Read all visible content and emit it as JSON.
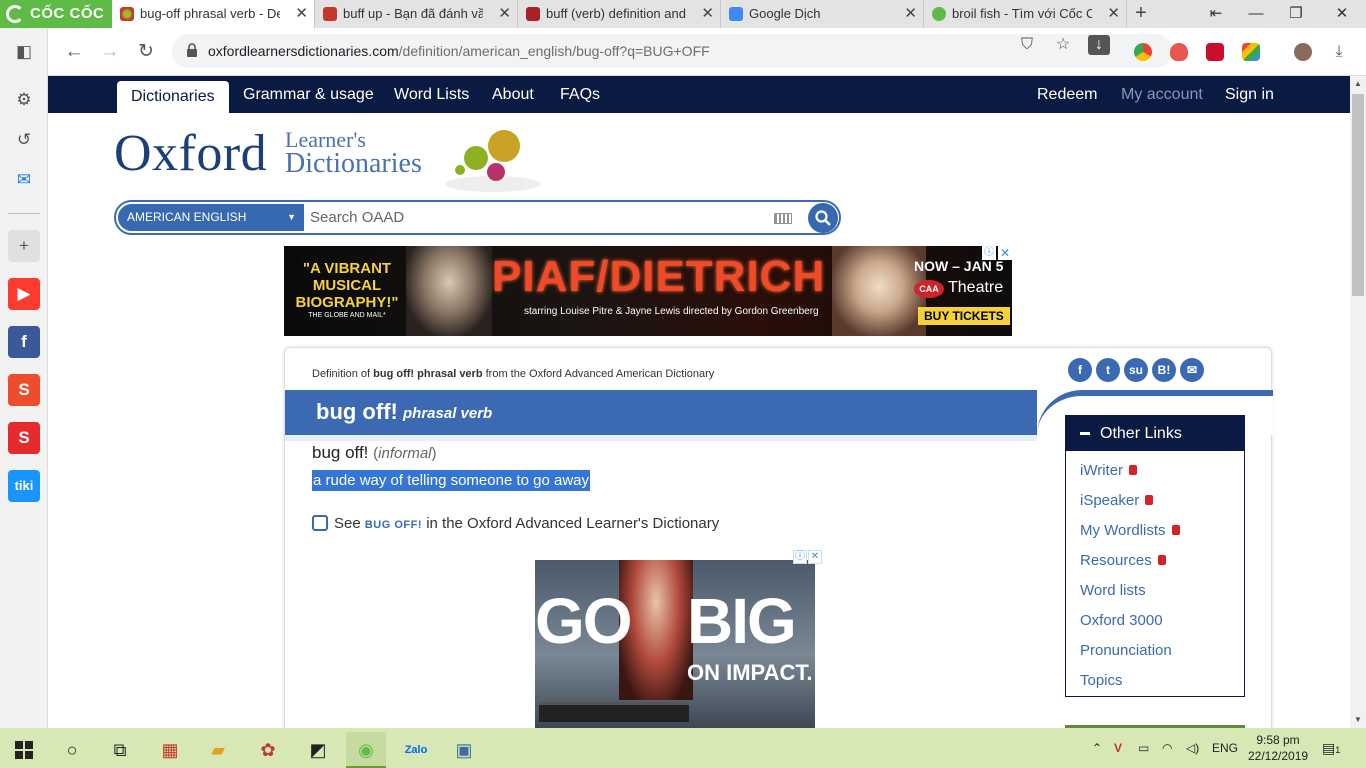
{
  "browser": {
    "brand": "CỐC CỐC",
    "tabs": [
      {
        "title": "bug-off phrasal verb - Definition",
        "active": true
      },
      {
        "title": "buff up - Bạn đã đánh vần",
        "active": false
      },
      {
        "title": "buff (verb) definition and sy",
        "active": false
      },
      {
        "title": "Google Dịch",
        "active": false
      },
      {
        "title": "broil fish - Tìm với Cốc Cốc",
        "active": false
      }
    ],
    "url_host": "oxfordlearnersdictionaries.com",
    "url_path": "/definition/american_english/bug-off?q=BUG+OFF"
  },
  "site_nav": {
    "left": [
      "Dictionaries",
      "Grammar & usage",
      "Word Lists",
      "About",
      "FAQs"
    ],
    "right": [
      "Redeem",
      "My account",
      "Sign in"
    ]
  },
  "logo": {
    "brand": "Oxford",
    "line1": "Learner's",
    "line2": "Dictionaries"
  },
  "search": {
    "language": "AMERICAN ENGLISH",
    "placeholder": "Search OAAD"
  },
  "top_ad": {
    "quote": "\"A VIBRANT MUSICAL BIOGRAPHY!\"",
    "quote_source": "THE GLOBE AND MAIL*",
    "title": "PIAF/DIETRICH",
    "starring": "starring Louise Pitre & Jayne Lewis  directed by Gordon Greenberg",
    "dates": "NOW – JAN 5",
    "venue_logo": "CAA",
    "venue": "Theatre",
    "cta": "BUY TICKETS"
  },
  "entry": {
    "breadcrumb_pre": "Definition of ",
    "breadcrumb_term": "bug off! phrasal verb",
    "breadcrumb_post": " from the Oxford Advanced American Dictionary",
    "headword": "bug off!",
    "pos": "phrasal verb",
    "form": "bug off!",
    "register": "informal",
    "definition": "a rude way of telling someone to go away",
    "see_pre": "See ",
    "see_ref": "BUG OFF!",
    "see_post": " in the Oxford Advanced Learner's Dictionary"
  },
  "share_icons": [
    "facebook-icon",
    "twitter-icon",
    "stumbleupon-icon",
    "hatena-icon",
    "email-icon"
  ],
  "side_ad": {
    "text1": "GO",
    "text2": "BIG",
    "text3": "ON IMPACT."
  },
  "other_links": {
    "title": "Other Links",
    "items": [
      {
        "label": "iWriter",
        "locked": true
      },
      {
        "label": "iSpeaker",
        "locked": true
      },
      {
        "label": "My Wordlists",
        "locked": true
      },
      {
        "label": "Resources",
        "locked": true
      },
      {
        "label": "Word lists",
        "locked": false
      },
      {
        "label": "Oxford 3000",
        "locked": false
      },
      {
        "label": "Pronunciation",
        "locked": false
      },
      {
        "label": "Topics",
        "locked": false
      }
    ]
  },
  "taskbar": {
    "lang": "ENG",
    "time": "9:58 pm",
    "date": "22/12/2019",
    "notifications": "1"
  }
}
